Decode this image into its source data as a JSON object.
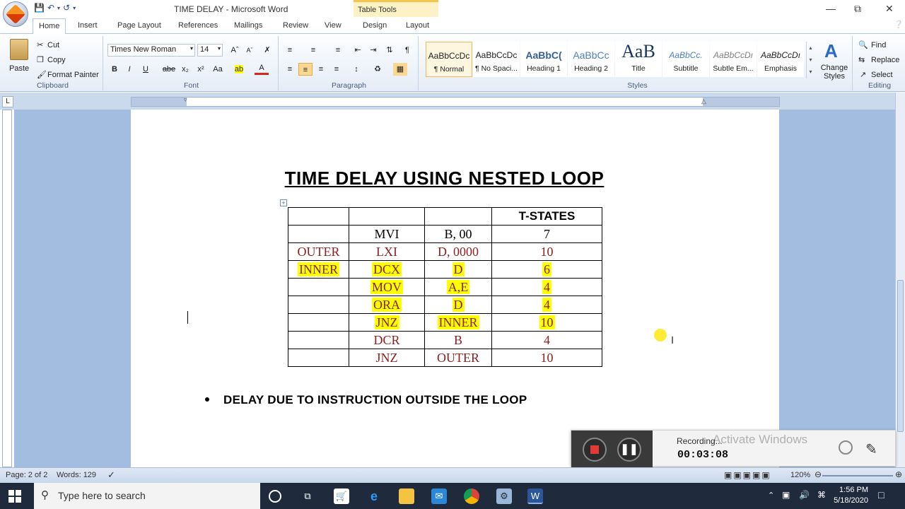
{
  "window": {
    "title": "TIME DELAY - Microsoft Word",
    "context_tab": "Table Tools"
  },
  "tabs": [
    "Home",
    "Insert",
    "Page Layout",
    "References",
    "Mailings",
    "Review",
    "View",
    "Design",
    "Layout"
  ],
  "ribbon": {
    "clipboard": {
      "paste": "Paste",
      "cut": "Cut",
      "copy": "Copy",
      "format_painter": "Format Painter",
      "label": "Clipboard"
    },
    "font": {
      "name": "Times New Roman",
      "size": "14",
      "label": "Font"
    },
    "paragraph": {
      "label": "Paragraph"
    },
    "styles": {
      "label": "Styles",
      "items": [
        {
          "sample": "AaBbCcDc",
          "name": "¶ Normal"
        },
        {
          "sample": "AaBbCcDc",
          "name": "¶ No Spaci..."
        },
        {
          "sample": "AaBbC(",
          "name": "Heading 1"
        },
        {
          "sample": "AaBbCc",
          "name": "Heading 2"
        },
        {
          "sample": "AaB",
          "name": "Title"
        },
        {
          "sample": "AaBbCc.",
          "name": "Subtitle"
        },
        {
          "sample": "AaBbCcDı",
          "name": "Subtle Em..."
        },
        {
          "sample": "AaBbCcDı",
          "name": "Emphasis"
        }
      ],
      "change_styles": "Change Styles"
    },
    "editing": {
      "find": "Find",
      "replace": "Replace",
      "select": "Select",
      "label": "Editing"
    }
  },
  "document": {
    "heading": "TIME DELAY USING NESTED LOOP",
    "table": {
      "rows": [
        [
          "",
          "",
          "",
          "T-STATES"
        ],
        [
          "",
          "MVI",
          "B, 00",
          "7"
        ],
        [
          "OUTER",
          "LXI",
          "D, 0000",
          "10"
        ],
        [
          "INNER",
          "DCX",
          "D",
          "6"
        ],
        [
          "",
          "MOV",
          "A,E",
          "4"
        ],
        [
          "",
          "ORA",
          "D",
          "4"
        ],
        [
          "",
          "JNZ",
          "INNER",
          "10"
        ],
        [
          "",
          "DCR",
          "B",
          "4"
        ],
        [
          "",
          "JNZ",
          "OUTER",
          "10"
        ]
      ]
    },
    "bullet": "DELAY DUE TO INSTRUCTION OUTSIDE THE LOOP"
  },
  "recording": {
    "status": "Recording...",
    "time": "00:03:08",
    "watermark": "Activate Windows"
  },
  "statusbar": {
    "page": "Page: 2 of 2",
    "words": "Words: 129",
    "zoom": "120%"
  },
  "taskbar": {
    "search_placeholder": "Type here to search",
    "time": "1:56 PM",
    "date": "5/18/2020"
  }
}
